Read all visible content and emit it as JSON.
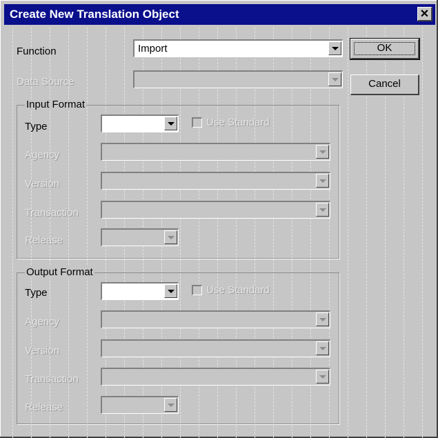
{
  "window": {
    "title": "Create New Translation Object",
    "close_glyph": "✕"
  },
  "function": {
    "label": "Function",
    "value": "Import"
  },
  "data_source": {
    "label": "Data Source",
    "value": ""
  },
  "buttons": {
    "ok": "OK",
    "cancel": "Cancel"
  },
  "input_format": {
    "title": "Input Format",
    "type_label": "Type",
    "type_value": "",
    "use_standard": "Use Standard",
    "agency_label": "Agency",
    "version_label": "Version",
    "transaction_label": "Transaction",
    "release_label": "Release"
  },
  "output_format": {
    "title": "Output Format",
    "type_label": "Type",
    "type_value": "",
    "use_standard": "Use Standard",
    "agency_label": "Agency",
    "version_label": "Version",
    "transaction_label": "Transaction",
    "release_label": "Release"
  },
  "colors": {
    "titlebar": "#0a0f8c",
    "face": "#c6c6c6"
  }
}
